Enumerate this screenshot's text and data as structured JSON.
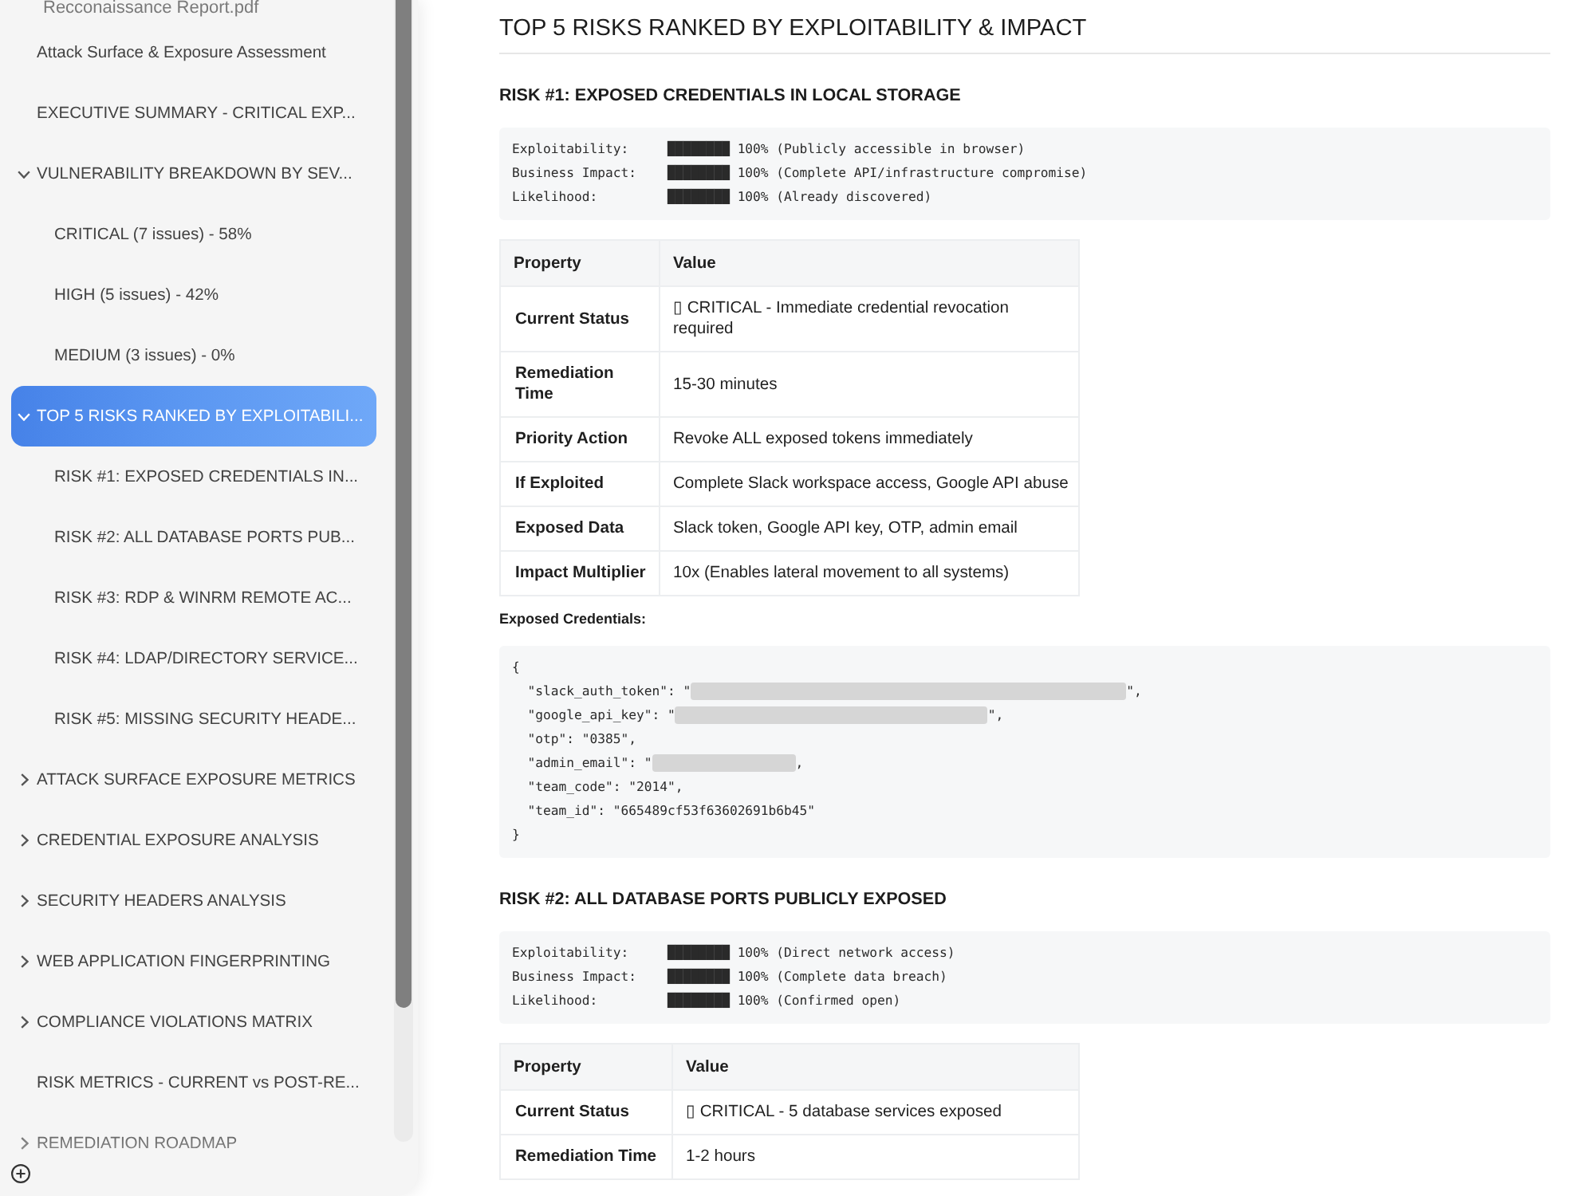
{
  "sidebar": {
    "file_title": "Recconaissance Report.pdf",
    "items": [
      {
        "label": "Attack Surface & Exposure Assessment",
        "selected": false
      },
      {
        "label": "EXECUTIVE SUMMARY - CRITICAL EXP...",
        "selected": false
      },
      {
        "label": "VULNERABILITY BREAKDOWN BY SEV...",
        "selected": false,
        "expanded": true,
        "children": [
          {
            "label": "CRITICAL (7 issues) - 58%",
            "selected": false
          },
          {
            "label": "HIGH (5 issues) - 42%",
            "selected": false
          },
          {
            "label": "MEDIUM (3 issues) - 0%",
            "selected": false
          }
        ]
      },
      {
        "label": "TOP 5 RISKS RANKED BY EXPLOITABILI...",
        "selected": true,
        "expanded": true,
        "children": [
          {
            "label": "RISK #1: EXPOSED CREDENTIALS IN...",
            "selected": false
          },
          {
            "label": "RISK #2: ALL DATABASE PORTS PUB...",
            "selected": false
          },
          {
            "label": "RISK #3: RDP & WINRM REMOTE AC...",
            "selected": false
          },
          {
            "label": "RISK #4: LDAP/DIRECTORY SERVICE...",
            "selected": false
          },
          {
            "label": "RISK #5: MISSING SECURITY HEADE...",
            "selected": false
          }
        ]
      },
      {
        "label": "ATTACK SURFACE EXPOSURE METRICS",
        "selected": false,
        "expanded": false
      },
      {
        "label": "CREDENTIAL EXPOSURE ANALYSIS",
        "selected": false,
        "expanded": false
      },
      {
        "label": "SECURITY HEADERS ANALYSIS",
        "selected": false,
        "expanded": false
      },
      {
        "label": "WEB APPLICATION FINGERPRINTING",
        "selected": false,
        "expanded": false
      },
      {
        "label": "COMPLIANCE VIOLATIONS MATRIX",
        "selected": false,
        "expanded": false
      },
      {
        "label": "RISK METRICS - CURRENT vs POST-RE...",
        "selected": false
      },
      {
        "label": "REMEDIATION ROADMAP",
        "selected": false,
        "expanded": false
      }
    ]
  },
  "document": {
    "title": "TOP 5 RISKS RANKED BY EXPLOITABILITY & IMPACT",
    "sections": [
      {
        "heading": "RISK #1: EXPOSED CREDENTIALS IN LOCAL STORAGE",
        "blocks": [
          {
            "kind": "code",
            "lines": [
              {
                "parts": [
                  {
                    "kind": "text",
                    "text": "Exploitability:     ████████ 100% (Publicly accessible in browser)"
                  }
                ]
              },
              {
                "parts": [
                  {
                    "kind": "text",
                    "text": "Business Impact:    ████████ 100% (Complete API/infrastructure compromise)"
                  }
                ]
              },
              {
                "parts": [
                  {
                    "kind": "text",
                    "text": "Likelihood:         ████████ 100% (Already discovered)"
                  }
                ]
              }
            ]
          },
          {
            "kind": "table",
            "columns": [
              "Property",
              "Value"
            ],
            "rows": [
              [
                "Current Status",
                "▯ CRITICAL - Immediate credential revocation required"
              ],
              [
                "Remediation Time",
                "15-30 minutes"
              ],
              [
                "Priority Action",
                "Revoke ALL exposed tokens immediately"
              ],
              [
                "If Exploited",
                "Complete Slack workspace access, Google API abuse"
              ],
              [
                "Exposed Data",
                "Slack token, Google API key, OTP, admin email"
              ],
              [
                "Impact Multiplier",
                "10x (Enables lateral movement to all systems)"
              ]
            ]
          },
          {
            "kind": "label",
            "text": "Exposed Credentials:"
          },
          {
            "kind": "code",
            "lines": [
              {
                "parts": [
                  {
                    "kind": "text",
                    "text": "{"
                  }
                ]
              },
              {
                "parts": [
                  {
                    "kind": "text",
                    "text": "  \"slack_auth_token\": \""
                  },
                  {
                    "kind": "redaction"
                  },
                  {
                    "kind": "text",
                    "text": "\","
                  }
                ]
              },
              {
                "parts": [
                  {
                    "kind": "text",
                    "text": "  \"google_api_key\": \""
                  },
                  {
                    "kind": "redaction"
                  },
                  {
                    "kind": "text",
                    "text": "\","
                  }
                ]
              },
              {
                "parts": [
                  {
                    "kind": "text",
                    "text": "  \"otp\": \"0385\","
                  }
                ]
              },
              {
                "parts": [
                  {
                    "kind": "text",
                    "text": "  \"admin_email\": \""
                  },
                  {
                    "kind": "redaction"
                  },
                  {
                    "kind": "text",
                    "text": ","
                  }
                ]
              },
              {
                "parts": [
                  {
                    "kind": "text",
                    "text": "  \"team_code\": \"2014\","
                  }
                ]
              },
              {
                "parts": [
                  {
                    "kind": "text",
                    "text": "  \"team_id\": \"665489cf53f63602691b6b45\""
                  }
                ]
              },
              {
                "parts": [
                  {
                    "kind": "text",
                    "text": "}"
                  }
                ]
              }
            ]
          }
        ]
      },
      {
        "heading": "RISK #2: ALL DATABASE PORTS PUBLICLY EXPOSED",
        "blocks": [
          {
            "kind": "code",
            "lines": [
              {
                "parts": [
                  {
                    "kind": "text",
                    "text": "Exploitability:     ████████ 100% (Direct network access)"
                  }
                ]
              },
              {
                "parts": [
                  {
                    "kind": "text",
                    "text": "Business Impact:    ████████ 100% (Complete data breach)"
                  }
                ]
              },
              {
                "parts": [
                  {
                    "kind": "text",
                    "text": "Likelihood:         ████████ 100% (Confirmed open)"
                  }
                ]
              }
            ]
          },
          {
            "kind": "table",
            "columns": [
              "Property",
              "Value"
            ],
            "rows": [
              [
                "Current Status",
                "▯ CRITICAL - 5 database services exposed"
              ],
              [
                "Remediation Time",
                "1-2 hours"
              ]
            ]
          }
        ]
      }
    ]
  }
}
